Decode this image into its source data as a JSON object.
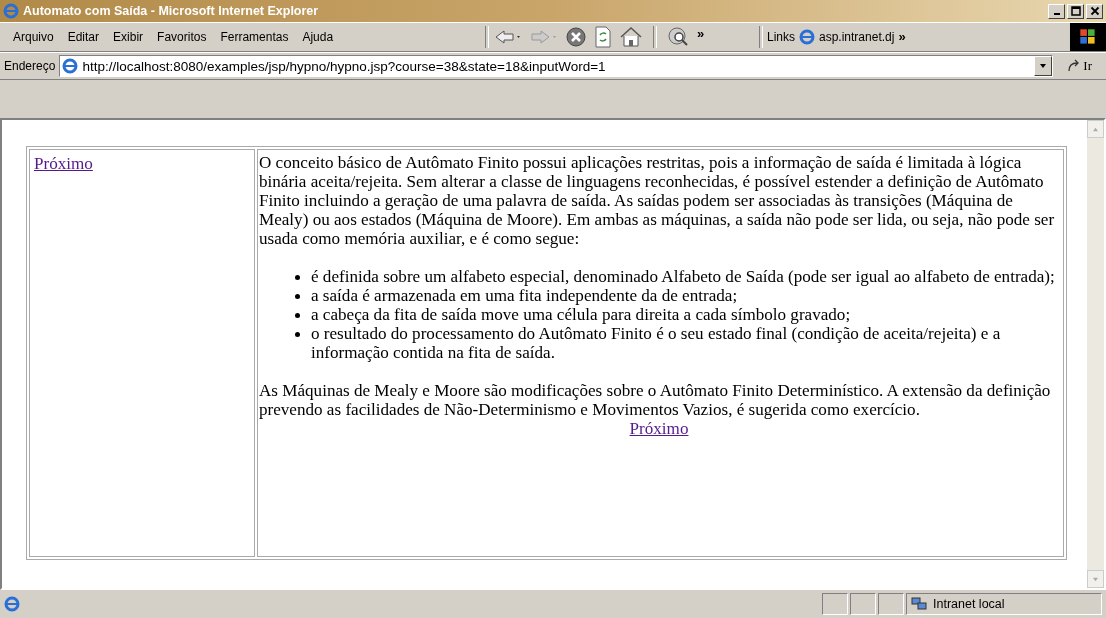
{
  "window": {
    "title": "Automato com Saída - Microsoft Internet Explorer"
  },
  "menu": [
    "Arquivo",
    "Editar",
    "Exibir",
    "Favoritos",
    "Ferramentas",
    "Ajuda"
  ],
  "toolbar": {
    "chevron": "»",
    "links_label": "Links",
    "link": "asp.intranet.dj",
    "links_chevron": "»"
  },
  "address_bar": {
    "label": "Endereço",
    "url": "http://localhost:8080/examples/jsp/hypno/hypno.jsp?course=38&state=18&inputWord=1",
    "go": "Ir"
  },
  "page": {
    "nav_link": "Próximo",
    "intro": "O conceito básico de Autômato Finito possui aplicações restritas, pois a informação de saída é limitada à lógica binária aceita/rejeita. Sem alterar a classe de linguagens reconhecidas, é possível estender a definição de Autômato Finito incluindo a geração de uma palavra de saída. As saídas podem ser associadas às transições (Máquina de Mealy) ou aos estados (Máquina de Moore). Em ambas as máquinas, a saída não pode ser lida, ou seja, não pode ser usada como memória auxiliar, e é como segue:",
    "bullets": [
      "é definida sobre um alfabeto especial, denominado Alfabeto de Saída (pode ser igual ao alfabeto de entrada);",
      "a saída é armazenada em uma fita independente da de entrada;",
      "a cabeça da fita de saída move uma célula para direita a cada símbolo gravado;",
      "o resultado do processamento do Autômato Finito é o seu estado final (condição de aceita/rejeita) e a informação contida na fita de saída."
    ],
    "outro": "As Máquinas de Mealy e Moore são modificações sobre o Autômato Finito Determinístico. A extensão da definição prevendo as facilidades de Não-Determinismo e Movimentos Vazios, é sugerida como exercício.",
    "next_link": "Próximo"
  },
  "status_bar": {
    "zone": "Intranet local"
  }
}
